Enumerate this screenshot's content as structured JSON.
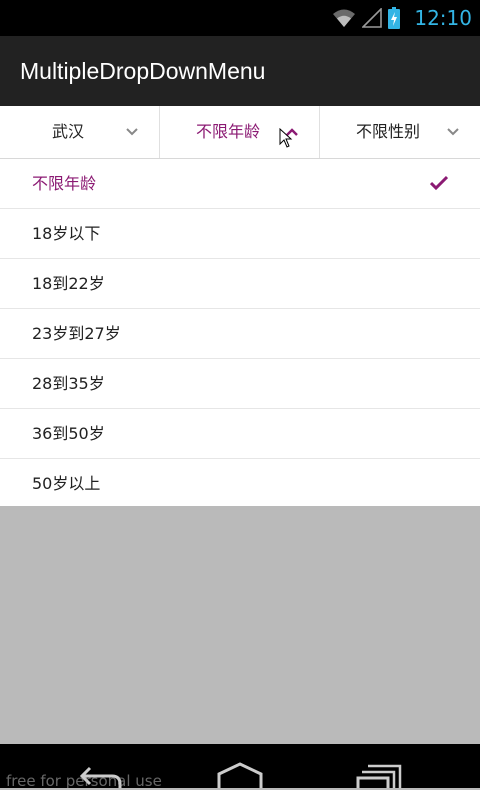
{
  "status_bar": {
    "time": "12:10"
  },
  "app_bar": {
    "title": "MultipleDropDownMenu"
  },
  "filters": [
    {
      "label": "武汉",
      "active": false
    },
    {
      "label": "不限年龄",
      "active": true
    },
    {
      "label": "不限性别",
      "active": false
    }
  ],
  "dropdown": {
    "items": [
      {
        "label": "不限年龄",
        "selected": true
      },
      {
        "label": "18岁以下"
      },
      {
        "label": "18到22岁"
      },
      {
        "label": "23岁到27岁"
      },
      {
        "label": "28到35岁"
      },
      {
        "label": "36到50岁"
      },
      {
        "label": "50岁以上"
      }
    ]
  },
  "watermark": "free for personal use",
  "colors": {
    "accent": "#8b1a73",
    "clock": "#33b5e5",
    "overlay": "#bababa"
  }
}
